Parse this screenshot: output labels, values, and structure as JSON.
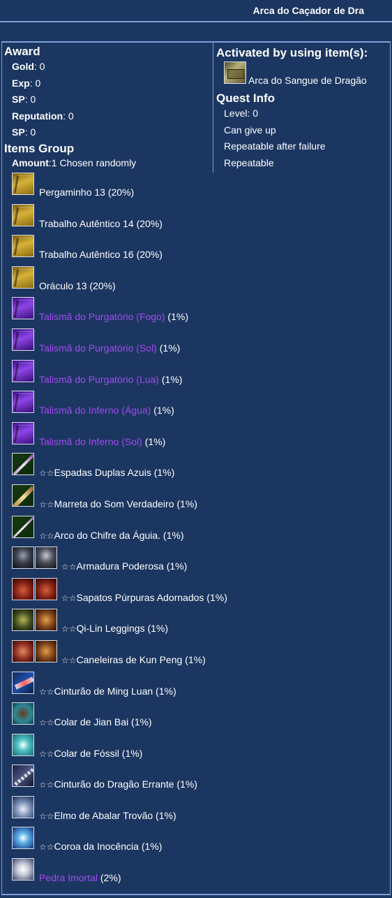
{
  "window": {
    "title": "Arca do Caçador de Dra"
  },
  "award": {
    "heading": "Award",
    "rows": [
      {
        "key": "Gold",
        "value": ": 0"
      },
      {
        "key": "Exp",
        "value": ": 0"
      },
      {
        "key": "SP",
        "value": ": 0"
      },
      {
        "key": "Reputation",
        "value": ": 0"
      },
      {
        "key": "SP",
        "value": ": 0"
      }
    ]
  },
  "items_group": {
    "heading": "Items Group",
    "amount_key": "Amount",
    "amount_value": ":1  Chosen randomly"
  },
  "activated": {
    "heading": "Activated by using item(s):",
    "item_label": "Arca do Sangue de Dragão",
    "item_icon": "chest-icon"
  },
  "quest_info": {
    "heading": "Quest Info",
    "rows": [
      "Level: 0",
      "Can give up",
      "Repeatable after failure",
      "Repeatable"
    ]
  },
  "colors": {
    "background": "#1b3660",
    "border": "#7f9fd6",
    "purple": "#a24bf0",
    "text": "#ffffff"
  },
  "items": [
    {
      "stars": "",
      "name": "Pergaminho 13",
      "suffix": " (20%)",
      "purple": false,
      "icons": [
        "book-gold-icon"
      ]
    },
    {
      "stars": "",
      "name": "Trabalho Autêntico 14",
      "suffix": " (20%)",
      "purple": false,
      "icons": [
        "book-gold-icon"
      ]
    },
    {
      "stars": "",
      "name": "Trabalho Autêntico 16",
      "suffix": " (20%)",
      "purple": false,
      "icons": [
        "book-gold-icon"
      ]
    },
    {
      "stars": "",
      "name": "Oráculo 13",
      "suffix": " (20%)",
      "purple": false,
      "icons": [
        "book-gold-icon"
      ]
    },
    {
      "stars": "",
      "name": "Talismã do Purgatório (Fogo)",
      "suffix": " (1%)",
      "purple": true,
      "icons": [
        "book-purple-icon"
      ]
    },
    {
      "stars": "",
      "name": "Talismã do Purgatório (Sol)",
      "suffix": " (1%)",
      "purple": true,
      "icons": [
        "book-purple-icon"
      ]
    },
    {
      "stars": "",
      "name": "Talismã do Purgatório (Lua)",
      "suffix": " (1%)",
      "purple": true,
      "icons": [
        "book-purple-icon"
      ]
    },
    {
      "stars": "",
      "name": "Talismã do Inferno (Água)",
      "suffix": " (1%)",
      "purple": true,
      "icons": [
        "book-purple-icon"
      ]
    },
    {
      "stars": "",
      "name": "Talismã do Inferno (Sol)",
      "suffix": " (1%)",
      "purple": true,
      "icons": [
        "book-purple-icon"
      ]
    },
    {
      "stars": "☆☆",
      "name": "Espadas Duplas Azuis",
      "suffix": " (1%)",
      "purple": false,
      "icons": [
        "twin-swords-icon"
      ]
    },
    {
      "stars": "☆☆",
      "name": "Marreta do Som Verdadeiro",
      "suffix": " (1%)",
      "purple": false,
      "icons": [
        "hammer-icon"
      ]
    },
    {
      "stars": "☆☆",
      "name": "Arco do Chifre da Águia.",
      "suffix": " (1%)",
      "purple": false,
      "icons": [
        "bow-icon"
      ]
    },
    {
      "stars": "☆☆",
      "name": "Armadura Poderosa",
      "suffix": " (1%)",
      "purple": false,
      "icons": [
        "armor-male-icon",
        "armor-female-icon"
      ]
    },
    {
      "stars": "☆☆",
      "name": "Sapatos Púrpuras Adornados",
      "suffix": " (1%)",
      "purple": false,
      "icons": [
        "shoes-male-icon",
        "shoes-female-icon"
      ]
    },
    {
      "stars": "☆☆",
      "name": "Qi-Lin Leggings",
      "suffix": " (1%)",
      "purple": false,
      "icons": [
        "leggings-male-icon",
        "leggings-female-icon"
      ]
    },
    {
      "stars": "☆☆",
      "name": "Caneleiras de Kun Peng",
      "suffix": " (1%)",
      "purple": false,
      "icons": [
        "greaves-male-icon",
        "greaves-female-icon"
      ]
    },
    {
      "stars": "☆☆",
      "name": "Cinturão de Ming Luan",
      "suffix": " (1%)",
      "purple": false,
      "icons": [
        "belt-icon"
      ]
    },
    {
      "stars": "☆☆",
      "name": "Colar de Jian Bai",
      "suffix": " (1%)",
      "purple": false,
      "icons": [
        "necklace-icon"
      ]
    },
    {
      "stars": "☆☆",
      "name": "Colar de Fóssil",
      "suffix": " (1%)",
      "purple": false,
      "icons": [
        "fossil-necklace-icon"
      ]
    },
    {
      "stars": "☆☆",
      "name": "Cinturão do Dragão Errante",
      "suffix": " (1%)",
      "purple": false,
      "icons": [
        "chain-belt-icon"
      ]
    },
    {
      "stars": "☆☆",
      "name": "Elmo de Abalar Trovão",
      "suffix": " (1%)",
      "purple": false,
      "icons": [
        "helm-icon"
      ]
    },
    {
      "stars": "☆☆",
      "name": "Coroa da Inocência",
      "suffix": " (1%)",
      "purple": false,
      "icons": [
        "crown-icon"
      ]
    },
    {
      "stars": "",
      "name": "Pedra Imortal",
      "suffix": " (2%)",
      "purple": true,
      "icons": [
        "stone-icon"
      ]
    }
  ]
}
